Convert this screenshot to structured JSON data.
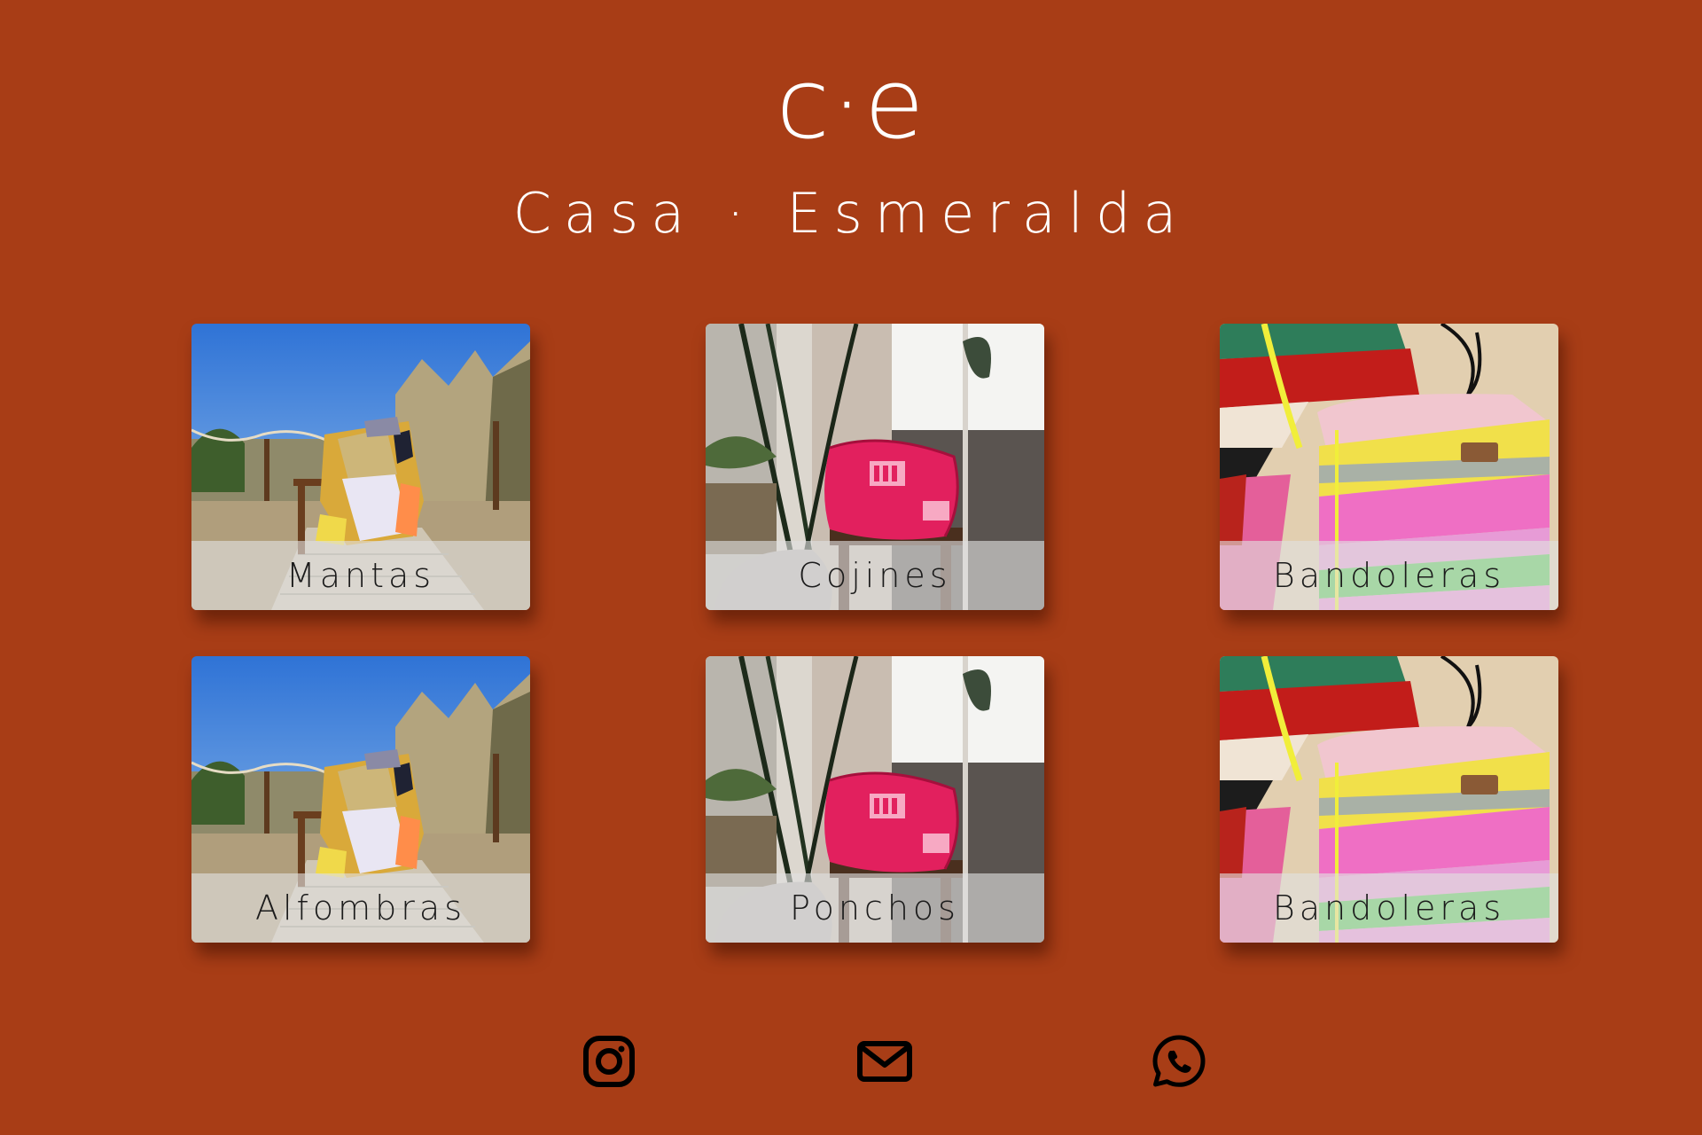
{
  "header": {
    "logo": "c·e",
    "title": "Casa · Esmeralda"
  },
  "categories": [
    {
      "label": "Mantas",
      "image": "blanket-on-chair-beach-photo"
    },
    {
      "label": "Cojines",
      "image": "pink-cushion-on-stool-photo"
    },
    {
      "label": "Bandoleras",
      "image": "striped-tufted-bag-photo"
    },
    {
      "label": "Alfombras",
      "image": "blanket-on-chair-beach-photo"
    },
    {
      "label": "Ponchos",
      "image": "pink-cushion-on-stool-photo"
    },
    {
      "label": "Bandoleras",
      "image": "striped-tufted-bag-photo"
    }
  ],
  "footer": {
    "icons": [
      "instagram-icon",
      "mail-icon",
      "whatsapp-icon"
    ]
  },
  "colors": {
    "background": "#a83d16",
    "text": "#ffffff",
    "caption_text": "#1b1b1b",
    "icon": "#000000"
  }
}
